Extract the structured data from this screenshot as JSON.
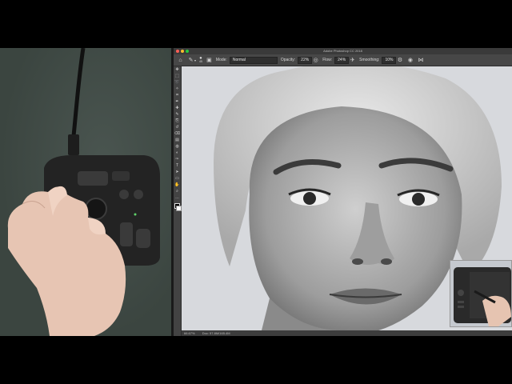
{
  "window": {
    "title": "Adobe Photoshop CC 2018"
  },
  "options_bar": {
    "brush_size": "45",
    "mode_label": "Mode:",
    "mode_value": "Normal",
    "opacity_label": "Opacity:",
    "opacity_value": "22%",
    "flow_label": "Flow:",
    "flow_value": "24%",
    "smoothing_label": "Smoothing:",
    "smoothing_value": "10%"
  },
  "status_bar": {
    "zoom": "66.67%",
    "doc_info": "Doc: 57.8M/165.4M"
  },
  "colors": {
    "app_bg": "#535353",
    "options_bar": "#474747",
    "toolbar": "#434343",
    "close": "#ff5f57",
    "minimize": "#febc2e",
    "maximize": "#28c840"
  },
  "toolbar": {
    "tools": [
      "move-icon",
      "marquee-icon",
      "lasso-icon",
      "quick-select-icon",
      "crop-icon",
      "eyedropper-icon",
      "healing-icon",
      "brush-icon",
      "stamp-icon",
      "history-brush-icon",
      "eraser-icon",
      "gradient-icon",
      "blur-icon",
      "dodge-icon",
      "pen-icon",
      "type-icon",
      "path-select-icon",
      "shape-icon",
      "hand-icon",
      "zoom-icon",
      "more-icon"
    ]
  }
}
